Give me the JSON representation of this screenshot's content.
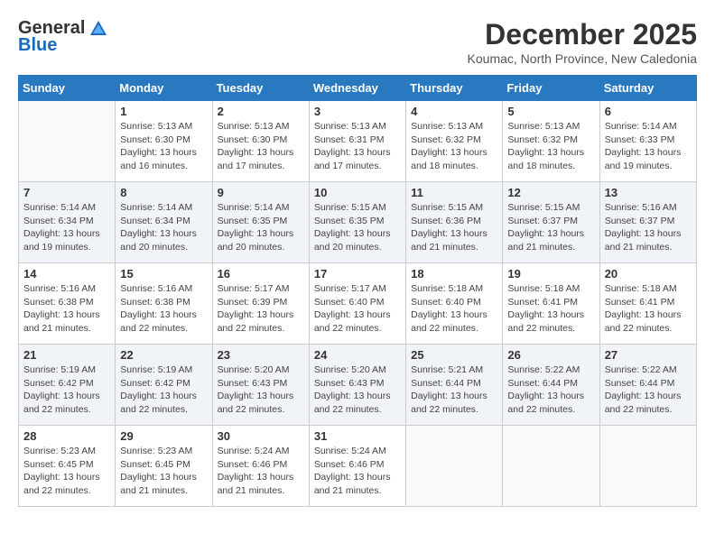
{
  "logo": {
    "general": "General",
    "blue": "Blue"
  },
  "header": {
    "month": "December 2025",
    "location": "Koumac, North Province, New Caledonia"
  },
  "days": [
    "Sunday",
    "Monday",
    "Tuesday",
    "Wednesday",
    "Thursday",
    "Friday",
    "Saturday"
  ],
  "weeks": [
    [
      {
        "day": "",
        "sunrise": "",
        "sunset": "",
        "daylight": ""
      },
      {
        "day": "1",
        "sunrise": "Sunrise: 5:13 AM",
        "sunset": "Sunset: 6:30 PM",
        "daylight": "Daylight: 13 hours and 16 minutes."
      },
      {
        "day": "2",
        "sunrise": "Sunrise: 5:13 AM",
        "sunset": "Sunset: 6:30 PM",
        "daylight": "Daylight: 13 hours and 17 minutes."
      },
      {
        "day": "3",
        "sunrise": "Sunrise: 5:13 AM",
        "sunset": "Sunset: 6:31 PM",
        "daylight": "Daylight: 13 hours and 17 minutes."
      },
      {
        "day": "4",
        "sunrise": "Sunrise: 5:13 AM",
        "sunset": "Sunset: 6:32 PM",
        "daylight": "Daylight: 13 hours and 18 minutes."
      },
      {
        "day": "5",
        "sunrise": "Sunrise: 5:13 AM",
        "sunset": "Sunset: 6:32 PM",
        "daylight": "Daylight: 13 hours and 18 minutes."
      },
      {
        "day": "6",
        "sunrise": "Sunrise: 5:14 AM",
        "sunset": "Sunset: 6:33 PM",
        "daylight": "Daylight: 13 hours and 19 minutes."
      }
    ],
    [
      {
        "day": "7",
        "sunrise": "Sunrise: 5:14 AM",
        "sunset": "Sunset: 6:34 PM",
        "daylight": "Daylight: 13 hours and 19 minutes."
      },
      {
        "day": "8",
        "sunrise": "Sunrise: 5:14 AM",
        "sunset": "Sunset: 6:34 PM",
        "daylight": "Daylight: 13 hours and 20 minutes."
      },
      {
        "day": "9",
        "sunrise": "Sunrise: 5:14 AM",
        "sunset": "Sunset: 6:35 PM",
        "daylight": "Daylight: 13 hours and 20 minutes."
      },
      {
        "day": "10",
        "sunrise": "Sunrise: 5:15 AM",
        "sunset": "Sunset: 6:35 PM",
        "daylight": "Daylight: 13 hours and 20 minutes."
      },
      {
        "day": "11",
        "sunrise": "Sunrise: 5:15 AM",
        "sunset": "Sunset: 6:36 PM",
        "daylight": "Daylight: 13 hours and 21 minutes."
      },
      {
        "day": "12",
        "sunrise": "Sunrise: 5:15 AM",
        "sunset": "Sunset: 6:37 PM",
        "daylight": "Daylight: 13 hours and 21 minutes."
      },
      {
        "day": "13",
        "sunrise": "Sunrise: 5:16 AM",
        "sunset": "Sunset: 6:37 PM",
        "daylight": "Daylight: 13 hours and 21 minutes."
      }
    ],
    [
      {
        "day": "14",
        "sunrise": "Sunrise: 5:16 AM",
        "sunset": "Sunset: 6:38 PM",
        "daylight": "Daylight: 13 hours and 21 minutes."
      },
      {
        "day": "15",
        "sunrise": "Sunrise: 5:16 AM",
        "sunset": "Sunset: 6:38 PM",
        "daylight": "Daylight: 13 hours and 22 minutes."
      },
      {
        "day": "16",
        "sunrise": "Sunrise: 5:17 AM",
        "sunset": "Sunset: 6:39 PM",
        "daylight": "Daylight: 13 hours and 22 minutes."
      },
      {
        "day": "17",
        "sunrise": "Sunrise: 5:17 AM",
        "sunset": "Sunset: 6:40 PM",
        "daylight": "Daylight: 13 hours and 22 minutes."
      },
      {
        "day": "18",
        "sunrise": "Sunrise: 5:18 AM",
        "sunset": "Sunset: 6:40 PM",
        "daylight": "Daylight: 13 hours and 22 minutes."
      },
      {
        "day": "19",
        "sunrise": "Sunrise: 5:18 AM",
        "sunset": "Sunset: 6:41 PM",
        "daylight": "Daylight: 13 hours and 22 minutes."
      },
      {
        "day": "20",
        "sunrise": "Sunrise: 5:18 AM",
        "sunset": "Sunset: 6:41 PM",
        "daylight": "Daylight: 13 hours and 22 minutes."
      }
    ],
    [
      {
        "day": "21",
        "sunrise": "Sunrise: 5:19 AM",
        "sunset": "Sunset: 6:42 PM",
        "daylight": "Daylight: 13 hours and 22 minutes."
      },
      {
        "day": "22",
        "sunrise": "Sunrise: 5:19 AM",
        "sunset": "Sunset: 6:42 PM",
        "daylight": "Daylight: 13 hours and 22 minutes."
      },
      {
        "day": "23",
        "sunrise": "Sunrise: 5:20 AM",
        "sunset": "Sunset: 6:43 PM",
        "daylight": "Daylight: 13 hours and 22 minutes."
      },
      {
        "day": "24",
        "sunrise": "Sunrise: 5:20 AM",
        "sunset": "Sunset: 6:43 PM",
        "daylight": "Daylight: 13 hours and 22 minutes."
      },
      {
        "day": "25",
        "sunrise": "Sunrise: 5:21 AM",
        "sunset": "Sunset: 6:44 PM",
        "daylight": "Daylight: 13 hours and 22 minutes."
      },
      {
        "day": "26",
        "sunrise": "Sunrise: 5:22 AM",
        "sunset": "Sunset: 6:44 PM",
        "daylight": "Daylight: 13 hours and 22 minutes."
      },
      {
        "day": "27",
        "sunrise": "Sunrise: 5:22 AM",
        "sunset": "Sunset: 6:44 PM",
        "daylight": "Daylight: 13 hours and 22 minutes."
      }
    ],
    [
      {
        "day": "28",
        "sunrise": "Sunrise: 5:23 AM",
        "sunset": "Sunset: 6:45 PM",
        "daylight": "Daylight: 13 hours and 22 minutes."
      },
      {
        "day": "29",
        "sunrise": "Sunrise: 5:23 AM",
        "sunset": "Sunset: 6:45 PM",
        "daylight": "Daylight: 13 hours and 21 minutes."
      },
      {
        "day": "30",
        "sunrise": "Sunrise: 5:24 AM",
        "sunset": "Sunset: 6:46 PM",
        "daylight": "Daylight: 13 hours and 21 minutes."
      },
      {
        "day": "31",
        "sunrise": "Sunrise: 5:24 AM",
        "sunset": "Sunset: 6:46 PM",
        "daylight": "Daylight: 13 hours and 21 minutes."
      },
      {
        "day": "",
        "sunrise": "",
        "sunset": "",
        "daylight": ""
      },
      {
        "day": "",
        "sunrise": "",
        "sunset": "",
        "daylight": ""
      },
      {
        "day": "",
        "sunrise": "",
        "sunset": "",
        "daylight": ""
      }
    ]
  ]
}
